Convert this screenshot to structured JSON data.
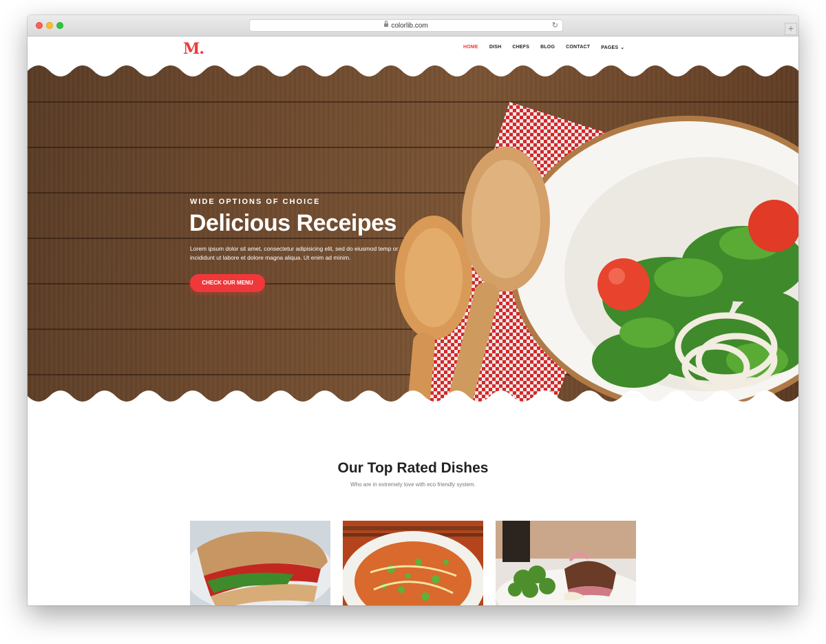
{
  "browser": {
    "url": "colorlib.com",
    "new_tab_symbol": "+",
    "reload_symbol": "↻"
  },
  "site": {
    "logo": "M.",
    "nav": [
      {
        "label": "HOME",
        "active": true
      },
      {
        "label": "DISH",
        "active": false
      },
      {
        "label": "CHEFS",
        "active": false
      },
      {
        "label": "BLOG",
        "active": false
      },
      {
        "label": "CONTACT",
        "active": false
      },
      {
        "label": "PAGES",
        "active": false,
        "dropdown": true
      }
    ],
    "dropdown_chevron": "⌄"
  },
  "hero": {
    "eyebrow": "WIDE OPTIONS OF CHOICE",
    "headline": "Delicious Receipes",
    "lead": "Lorem ipsum dolor sit amet, consectetur adipisicing elit, sed do eiusmod temp or incididunt ut labore et dolore magna aliqua. Ut enim ad minim.",
    "cta": "CHECK OUR MENU"
  },
  "dishes": {
    "title": "Our Top Rated Dishes",
    "subtitle": "Who are in extremely love with eco friendly system.",
    "items": [
      {
        "image": "sandwich-photo"
      },
      {
        "image": "noodle-bowl-photo"
      },
      {
        "image": "steak-broccoli-photo"
      }
    ]
  },
  "colors": {
    "accent": "#f0383a",
    "text_dark": "#222222",
    "wood": "#6e4a2e"
  }
}
